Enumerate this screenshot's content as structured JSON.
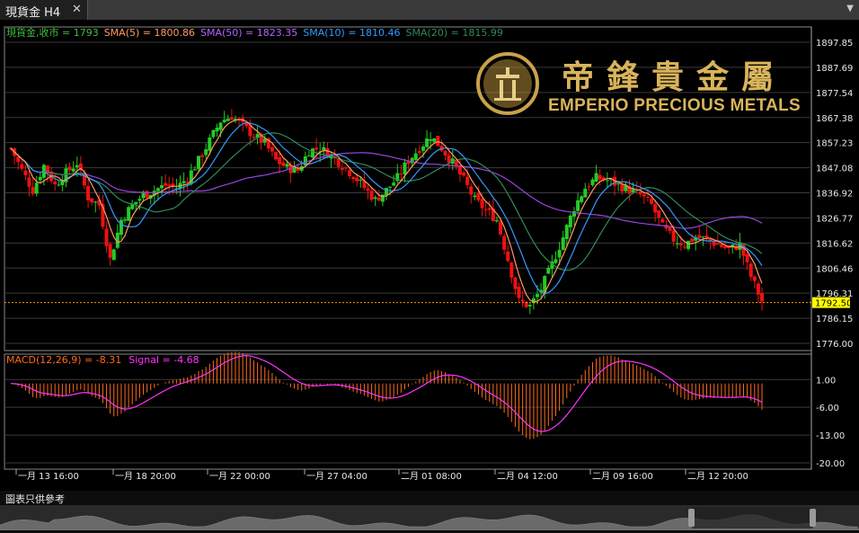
{
  "tab": {
    "title": "現貨金 H4",
    "close_glyph": "✕",
    "menu_glyph": "▼"
  },
  "legend": [
    {
      "text": "現貨金,收市 = 1793",
      "color": "#3fbf3f"
    },
    {
      "text": "SMA(5) = 1800.86",
      "color": "#ff9966"
    },
    {
      "text": "SMA(50) = 1823.35",
      "color": "#b066ff"
    },
    {
      "text": "SMA(10) = 1810.46",
      "color": "#3399ff"
    },
    {
      "text": "SMA(20) = 1815.99",
      "color": "#2e8b57"
    }
  ],
  "price_axis": [
    "1897.85",
    "1887.69",
    "1877.54",
    "1867.38",
    "1857.23",
    "1847.08",
    "1836.92",
    "1826.77",
    "1816.62",
    "1806.46",
    "1796.31",
    "1786.15",
    "1776.00"
  ],
  "current_price": "1792.50",
  "macd_label": "MACD(12,26,9) = -8.31",
  "signal_label": "Signal = -4.68",
  "macd_axis": [
    "1.00",
    "-6.00",
    "-13.00",
    "-20.00"
  ],
  "time_axis": [
    "一月 13 16:00",
    "一月 18 20:00",
    "一月 22 00:00",
    "一月 27 04:00",
    "二月 01 08:00",
    "二月 04 12:00",
    "二月 09 16:00",
    "二月 12 20:00"
  ],
  "disclaimer": "圖表只供參考",
  "logo": {
    "chinese": "帝鋒貴金屬",
    "english": "EMPERIO PRECIOUS METALS"
  },
  "colors": {
    "up": "#22cc22",
    "down": "#ee1111",
    "sma5": "#ff9966",
    "sma10": "#3399ff",
    "sma20": "#2e8b57",
    "sma50": "#9944dd",
    "macd_hist": "#ff6a1a",
    "signal": "#ff33ff",
    "price_tag": "#ffff00",
    "gold": "#c9a24a"
  },
  "chart_data": {
    "type": "candlestick",
    "price_range": [
      1776.0,
      1897.85
    ],
    "anchors": [
      1855,
      1846,
      1838,
      1848,
      1840,
      1845,
      1849,
      1835,
      1832,
      1810,
      1826,
      1832,
      1836,
      1838,
      1840,
      1839,
      1843,
      1850,
      1858,
      1866,
      1868,
      1864,
      1860,
      1857,
      1850,
      1847,
      1846,
      1854,
      1855,
      1852,
      1848,
      1844,
      1839,
      1834,
      1838,
      1843,
      1850,
      1855,
      1860,
      1855,
      1849,
      1842,
      1834,
      1830,
      1826,
      1810,
      1793,
      1791,
      1798,
      1808,
      1819,
      1831,
      1839,
      1843,
      1842,
      1840,
      1838,
      1836,
      1832,
      1823,
      1818,
      1816,
      1819,
      1818,
      1816,
      1814,
      1816,
      1803,
      1793
    ],
    "sma5_final": 1800.86,
    "sma10_final": 1810.46,
    "sma20_final": 1815.99,
    "sma50_final": 1823.35,
    "macd_final": -8.31,
    "signal_final": -4.68,
    "macd_range": [
      -20.0,
      4.0
    ]
  }
}
